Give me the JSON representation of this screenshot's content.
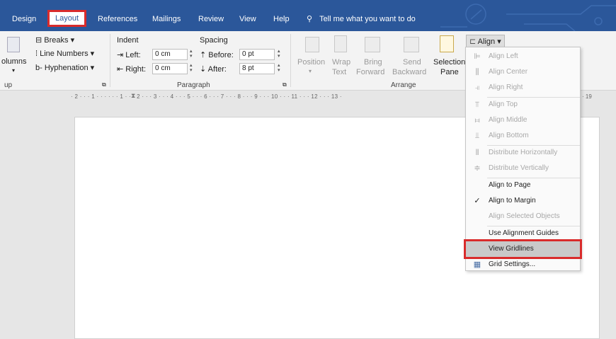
{
  "tabs": {
    "design": "Design",
    "layout": "Layout",
    "references": "References",
    "mailings": "Mailings",
    "review": "Review",
    "view": "View",
    "help": "Help",
    "tell_me": "Tell me what you want to do"
  },
  "page_setup": {
    "columns": "olumns",
    "breaks": "Breaks",
    "line_numbers": "Line Numbers",
    "hyphenation": "Hyphenation",
    "group_label": "up"
  },
  "paragraph": {
    "indent_label": "Indent",
    "spacing_label": "Spacing",
    "left_label": "Left:",
    "left_value": "0 cm",
    "right_label": "Right:",
    "right_value": "0 cm",
    "before_label": "Before:",
    "before_value": "0 pt",
    "after_label": "After:",
    "after_value": "8 pt",
    "group_label": "Paragraph"
  },
  "arrange": {
    "position": "Position",
    "wrap": "Wrap",
    "wrap2": "Text",
    "bring": "Bring",
    "bring2": "Forward",
    "send": "Send",
    "send2": "Backward",
    "selection": "Selection",
    "selection2": "Pane",
    "align": "Align",
    "group_label": "Arrange"
  },
  "ruler": {
    "text": "· 2 · · · 1 · · · · · · 1 · · · 2 · · · 3 · · · 4 · · · 5 · · · 6 · · · 7 · · · 8 · · · 9 · · · 10 · · · 11 · · · 12 · · · 13 ·",
    "end": "· 19"
  },
  "menu": {
    "align_left": "Align Left",
    "align_center": "Align Center",
    "align_right": "Align Right",
    "align_top": "Align Top",
    "align_middle": "Align Middle",
    "align_bottom": "Align Bottom",
    "distribute_h": "Distribute Horizontally",
    "distribute_v": "Distribute Vertically",
    "align_to_page": "Align to Page",
    "align_to_margin": "Align to Margin",
    "align_selected": "Align Selected Objects",
    "use_guides": "Use Alignment Guides",
    "view_gridlines": "View Gridlines",
    "grid_settings": "Grid Settings..."
  },
  "colors": {
    "ribbon_blue": "#2b579a",
    "highlight_red": "#d92b2b"
  }
}
